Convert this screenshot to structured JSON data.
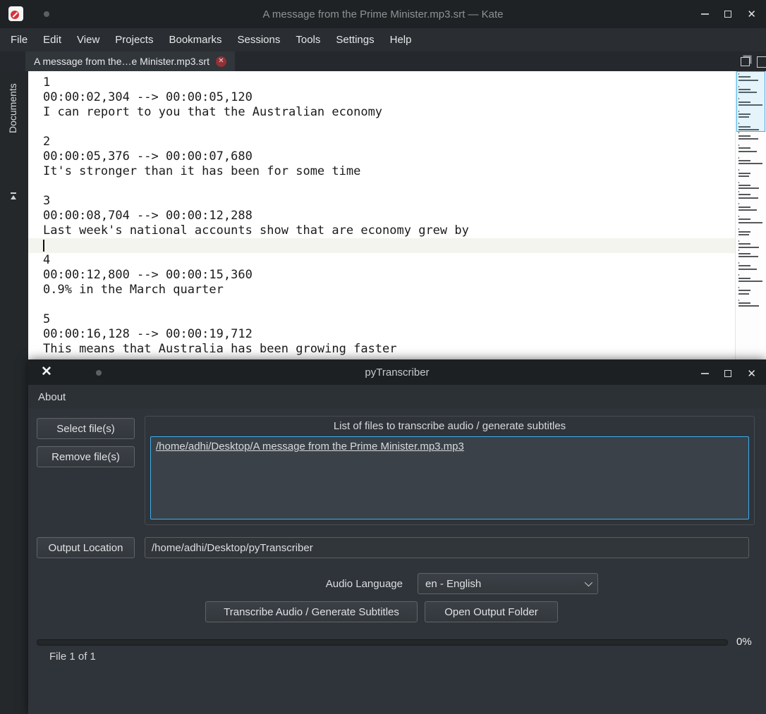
{
  "icons": {
    "close_glyph": "✕",
    "tab_close_glyph": "✕"
  },
  "kate": {
    "titlebar": {
      "title": "A message from the Prime Minister.mp3.srt — Kate"
    },
    "menu": [
      "File",
      "Edit",
      "View",
      "Projects",
      "Bookmarks",
      "Sessions",
      "Tools",
      "Settings",
      "Help"
    ],
    "tab": {
      "label": "A message from the…e Minister.mp3.srt"
    },
    "sidebar": {
      "label": "Documents"
    },
    "editor_lines": [
      "1",
      "00:00:02,304 --> 00:00:05,120",
      "I can report to you that the Australian economy",
      "",
      "2",
      "00:00:05,376 --> 00:00:07,680",
      "It's stronger than it has been for some time",
      "",
      "3",
      "00:00:08,704 --> 00:00:12,288",
      "Last week's national accounts show that are economy grew by",
      "",
      "4",
      "00:00:12,800 --> 00:00:15,360",
      "0.9% in the March quarter",
      "",
      "5",
      "00:00:16,128 --> 00:00:19,712",
      "This means that Australia has been growing faster"
    ],
    "cursor_line_index": 11
  },
  "pytranscriber": {
    "titlebar": {
      "title": "pyTranscriber"
    },
    "menu": [
      "About"
    ],
    "buttons": {
      "select_files": "Select file(s)",
      "remove_files": "Remove file(s)",
      "output_location": "Output Location",
      "transcribe": "Transcribe Audio / Generate Subtitles",
      "open_output": "Open Output Folder"
    },
    "file_list": {
      "group_title": "List of files to transcribe audio / generate subtitles",
      "items": [
        "/home/adhi/Desktop/A message from the Prime Minister.mp3.mp3"
      ]
    },
    "output_location_value": "/home/adhi/Desktop/pyTranscriber",
    "audio_language": {
      "label": "Audio Language",
      "selected": "en - English"
    },
    "progress": {
      "percent": 0,
      "value": "0%",
      "status": "File 1 of 1"
    }
  }
}
